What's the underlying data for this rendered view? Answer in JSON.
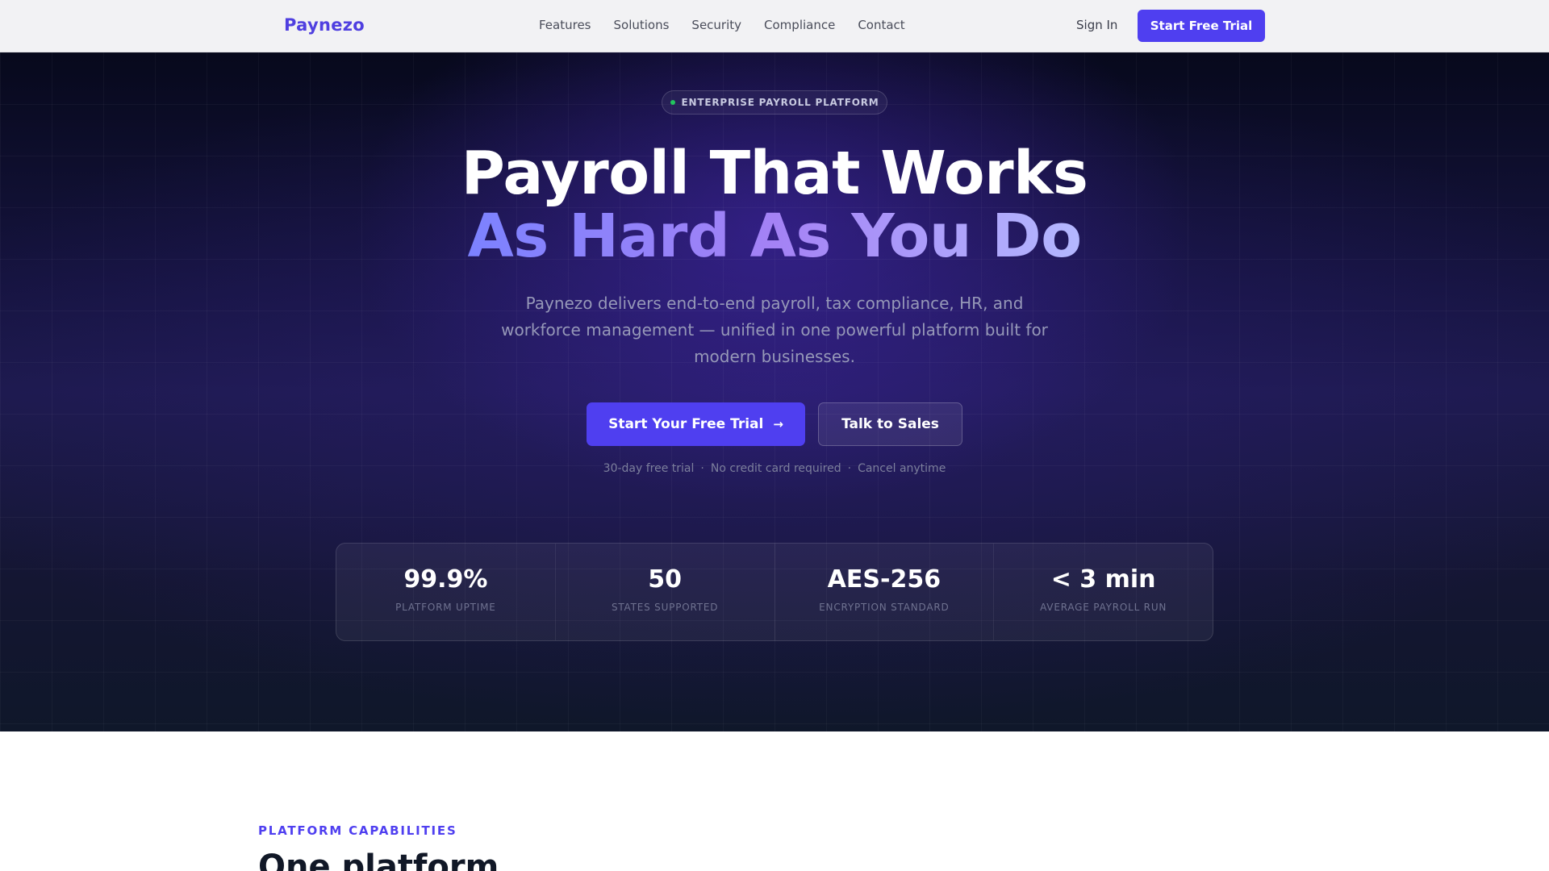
{
  "nav": {
    "logo": "Paynezo",
    "links": [
      "Features",
      "Solutions",
      "Security",
      "Compliance",
      "Contact"
    ],
    "sign_in": "Sign In",
    "cta": "Start Free Trial"
  },
  "hero": {
    "badge": "ENTERPRISE PAYROLL PLATFORM",
    "headline_line1": "Payroll That Works",
    "headline_line2": "As Hard As You Do",
    "subtext": "Paynezo delivers end-to-end payroll, tax compliance, HR, and workforce management — unified in one powerful platform built for modern businesses.",
    "cta_primary": "Start Your Free Trial",
    "cta_primary_icon": "arrow-right-icon",
    "cta_secondary": "Talk to Sales",
    "trial_notes": [
      "30-day free trial",
      "No credit card required",
      "Cancel anytime"
    ],
    "stats": [
      {
        "value": "99.9%",
        "label": "PLATFORM UPTIME"
      },
      {
        "value": "50",
        "label": "STATES SUPPORTED"
      },
      {
        "value": "AES-256",
        "label": "ENCRYPTION STANDARD"
      },
      {
        "value": "< 3 min",
        "label": "AVERAGE PAYROLL RUN"
      }
    ]
  },
  "capabilities": {
    "eyebrow": "PLATFORM CAPABILITIES",
    "title": "One platform."
  },
  "colors": {
    "brand": "#4f3ff0",
    "badge_dot": "#22c55e",
    "hero_bg": "#161440"
  }
}
